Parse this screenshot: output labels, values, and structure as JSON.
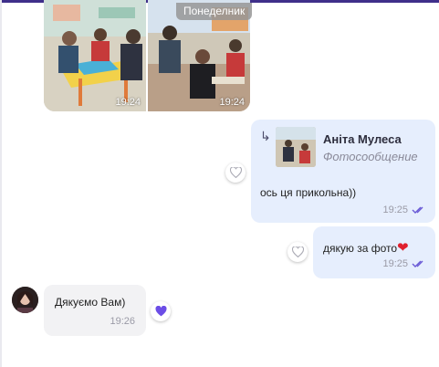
{
  "chat": {
    "day_label": "Понеделник",
    "photos": [
      {
        "time": "19:24"
      },
      {
        "time": "19:24"
      }
    ],
    "outgoing": [
      {
        "reply_author": "Аніта Мулеса",
        "reply_type": "Фотосообщение",
        "text": "ось ця прикольна))",
        "time": "19:25"
      },
      {
        "text": "дякую за фото",
        "emoji": "❤",
        "time": "19:25"
      }
    ],
    "incoming": [
      {
        "text": "Дякуємо Вам)",
        "time": "19:26"
      }
    ]
  },
  "colors": {
    "accent": "#3f2f8a",
    "bubble_out": "#e6eefd",
    "bubble_in": "#f2f2f4",
    "reaction_heart": "#6b4de6",
    "emoji_heart": "#e0202e"
  }
}
